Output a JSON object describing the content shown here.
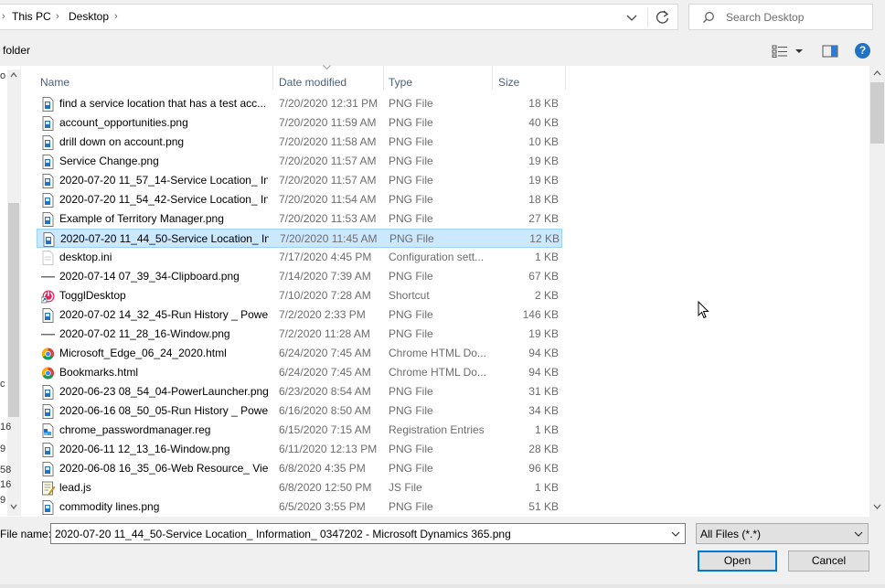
{
  "address_bar": {
    "crumbs": [
      "This PC",
      "Desktop"
    ]
  },
  "search": {
    "placeholder": "Search Desktop"
  },
  "toolbar": {
    "new_folder_label": "folder",
    "help_label": "?"
  },
  "nav_fragments": [
    "o",
    "c",
    "16",
    "9",
    "58",
    "16",
    "9"
  ],
  "columns": {
    "name": "Name",
    "date": "Date modified",
    "type": "Type",
    "size": "Size"
  },
  "files": [
    {
      "name": "find a service location that has a test acc...",
      "date": "7/20/2020 12:31 PM",
      "type": "PNG File",
      "size": "18 KB",
      "icon": "png-file-icon"
    },
    {
      "name": "account_opportunities.png",
      "date": "7/20/2020 11:59 AM",
      "type": "PNG File",
      "size": "40 KB",
      "icon": "png-file-icon"
    },
    {
      "name": "drill down on account.png",
      "date": "7/20/2020 11:58 AM",
      "type": "PNG File",
      "size": "10 KB",
      "icon": "png-file-icon"
    },
    {
      "name": "Service Change.png",
      "date": "7/20/2020 11:57 AM",
      "type": "PNG File",
      "size": "19 KB",
      "icon": "png-file-icon"
    },
    {
      "name": "2020-07-20 11_57_14-Service Location_ In...",
      "date": "7/20/2020 11:57 AM",
      "type": "PNG File",
      "size": "19 KB",
      "icon": "png-file-icon"
    },
    {
      "name": "2020-07-20 11_54_42-Service Location_ In...",
      "date": "7/20/2020 11:54 AM",
      "type": "PNG File",
      "size": "18 KB",
      "icon": "png-file-icon"
    },
    {
      "name": "Example of Territory Manager.png",
      "date": "7/20/2020 11:53 AM",
      "type": "PNG File",
      "size": "27 KB",
      "icon": "png-file-icon"
    },
    {
      "name": "2020-07-20 11_44_50-Service Location_ In...",
      "date": "7/20/2020 11:45 AM",
      "type": "PNG File",
      "size": "12 KB",
      "icon": "png-file-icon",
      "selected": true
    },
    {
      "name": "desktop.ini",
      "date": "7/17/2020 4:45 PM",
      "type": "Configuration sett...",
      "size": "1 KB",
      "icon": "ini-file-icon"
    },
    {
      "name": "2020-07-14 07_39_34-Clipboard.png",
      "date": "7/14/2020 7:39 AM",
      "type": "PNG File",
      "size": "67 KB",
      "icon": "thin-image-icon"
    },
    {
      "name": "TogglDesktop",
      "date": "7/10/2020 7:28 AM",
      "type": "Shortcut",
      "size": "2 KB",
      "icon": "toggl-shortcut-icon"
    },
    {
      "name": "2020-07-02 14_32_45-Run History _ Powe...",
      "date": "7/2/2020 2:33 PM",
      "type": "PNG File",
      "size": "146 KB",
      "icon": "png-file-icon"
    },
    {
      "name": "2020-07-02 11_28_16-Window.png",
      "date": "7/2/2020 11:28 AM",
      "type": "PNG File",
      "size": "19 KB",
      "icon": "thin-image-icon"
    },
    {
      "name": "Microsoft_Edge_06_24_2020.html",
      "date": "6/24/2020 7:45 AM",
      "type": "Chrome HTML Do...",
      "size": "94 KB",
      "icon": "chrome-icon"
    },
    {
      "name": "Bookmarks.html",
      "date": "6/24/2020 7:45 AM",
      "type": "Chrome HTML Do...",
      "size": "94 KB",
      "icon": "chrome-icon"
    },
    {
      "name": "2020-06-23 08_54_04-PowerLauncher.png",
      "date": "6/23/2020 8:54 AM",
      "type": "PNG File",
      "size": "31 KB",
      "icon": "png-file-icon"
    },
    {
      "name": "2020-06-16 08_50_05-Run History _ Powe...",
      "date": "6/16/2020 8:50 AM",
      "type": "PNG File",
      "size": "34 KB",
      "icon": "png-file-icon"
    },
    {
      "name": "chrome_passwordmanager.reg",
      "date": "6/15/2020 7:15 AM",
      "type": "Registration Entries",
      "size": "1 KB",
      "icon": "registry-file-icon"
    },
    {
      "name": "2020-06-11 12_13_16-Window.png",
      "date": "6/11/2020 12:13 PM",
      "type": "PNG File",
      "size": "28 KB",
      "icon": "png-file-icon"
    },
    {
      "name": "2020-06-08 16_35_06-Web Resource_ Vie...",
      "date": "6/8/2020 4:35 PM",
      "type": "PNG File",
      "size": "96 KB",
      "icon": "png-file-icon"
    },
    {
      "name": "lead.js",
      "date": "6/8/2020 12:50 PM",
      "type": "JS File",
      "size": "1 KB",
      "icon": "js-file-icon"
    },
    {
      "name": "commodity lines.png",
      "date": "6/5/2020 3:55 PM",
      "type": "PNG File",
      "size": "51 KB",
      "icon": "png-file-icon"
    }
  ],
  "footer": {
    "file_name_label": "File name:",
    "file_name_value": "2020-07-20 11_44_50-Service Location_ Information_ 0347202 - Microsoft Dynamics 365.png",
    "filter_value": "All Files (*.*)",
    "open_label": "Open",
    "cancel_label": "Cancel"
  },
  "colors": {
    "selection_bg": "#cce8ff",
    "selection_border": "#99d1ff",
    "accent": "#0078d7",
    "header_text": "#4c607a"
  }
}
